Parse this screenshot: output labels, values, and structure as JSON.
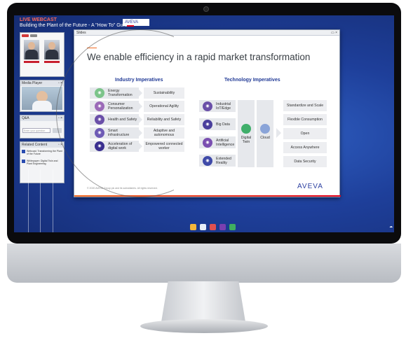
{
  "webcast": {
    "live_label": "LIVE WEBCAST",
    "event_title": "Building the Plant of the Future - A \"How To\" Guide",
    "window_title": "Slides",
    "media_player_title": "Media Player",
    "qa_title": "Q&A",
    "qa_placeholder": "Enter your question",
    "related_title": "Related Content",
    "related_items": [
      "Webcast: Transforming the Plant of the Future",
      "Whitepaper: Digital Twin and Plant Engineering"
    ]
  },
  "slide": {
    "title": "We enable efficiency in a rapid market transformation",
    "industry_head": "Industry Imperatives",
    "technology_head": "Technology Imperatives",
    "industry_rows": [
      {
        "left": "Energy Transformation",
        "right": "Sustainability",
        "color": "#7cc48a"
      },
      {
        "left": "Consumer Personalization",
        "right": "Operational Agility",
        "color": "#9b6ab8"
      },
      {
        "left": "Health and Safety",
        "right": "Reliability and Safety",
        "color": "#6a4fa8"
      },
      {
        "left": "Smart infrastructure",
        "right": "Adaptive and autonomous",
        "color": "#6e5bb5"
      },
      {
        "left": "Acceleration of digital work",
        "right": "Empowered connected worker",
        "color": "#3a2f8f"
      }
    ],
    "tech_rows": [
      {
        "label": "Industrial IoT/Edge",
        "color": "#6a4fa8"
      },
      {
        "label": "Big Data",
        "color": "#4a3f9c"
      },
      {
        "label": "Artificial Intelligence",
        "color": "#7a4fb0"
      },
      {
        "label": "Extended Reality",
        "color": "#3f4aa8"
      }
    ],
    "digital_twin": "Digital Twin",
    "cloud": "Cloud",
    "outcomes": [
      "Standardize and Scale",
      "Flexible Consumption",
      "Open",
      "Access Anywhere",
      "Data Security"
    ],
    "copyright": "© 2020 AVEVA Group plc and its subsidiaries. All rights reserved.",
    "logo": "AVEVA"
  },
  "header_logo": "AVEVA",
  "colors": {
    "accent": "#f26a21",
    "brand": "#213a96",
    "desktop": "#1e3f9a"
  }
}
